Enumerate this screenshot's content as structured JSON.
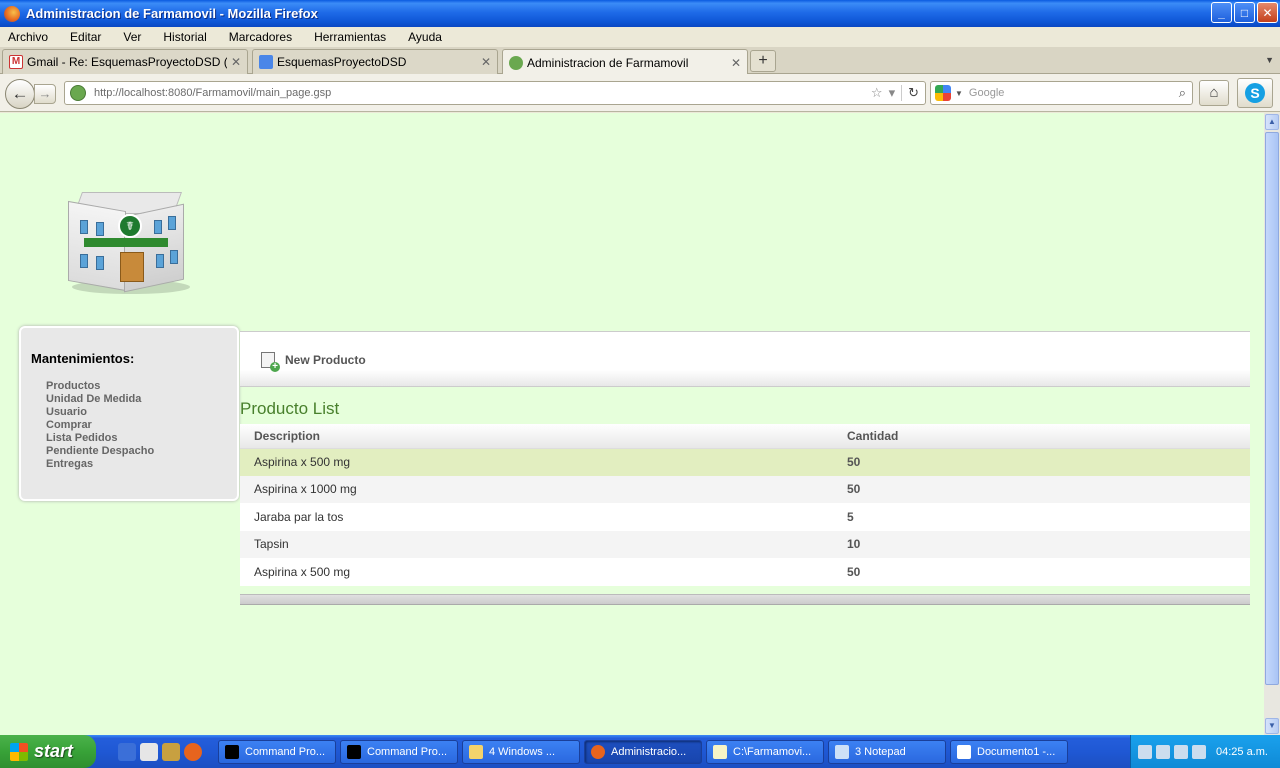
{
  "window": {
    "title": "Administracion de Farmamovil - Mozilla Firefox",
    "controls": {
      "minimize": "_",
      "maximize": "□",
      "close": "✕"
    }
  },
  "menubar": [
    "Archivo",
    "Editar",
    "Ver",
    "Historial",
    "Marcadores",
    "Herramientas",
    "Ayuda"
  ],
  "tabs": [
    {
      "label": "Gmail - Re: EsquemasProyectoDSD (ymal...",
      "icon": "gmail-icon",
      "close": "✕"
    },
    {
      "label": "EsquemasProyectoDSD",
      "icon": "doc-icon",
      "close": "✕"
    },
    {
      "label": "Administracion de Farmamovil",
      "icon": "site-icon",
      "close": "✕",
      "active": true
    }
  ],
  "newtab_label": "+",
  "nav": {
    "back": "←",
    "forward": "→",
    "url": "http://localhost:8080/Farmamovil/main_page.gsp",
    "bookmark_star": "☆",
    "dropdown": "▾",
    "reload": "↻",
    "search_placeholder": "Google",
    "search_icon": "⌕",
    "home": "⌂",
    "skype": "S"
  },
  "logo": {
    "sign": "☤"
  },
  "sidebar": {
    "title": "Mantenimientos:",
    "items": [
      "Productos",
      "Unidad De Medida",
      "Usuario",
      "Comprar",
      "Lista Pedidos",
      "Pendiente Despacho",
      "Entregas"
    ]
  },
  "actions": {
    "new_producto": "New Producto"
  },
  "list": {
    "title": "Producto List",
    "columns": [
      "Description",
      "Cantidad"
    ],
    "rows": [
      {
        "description": "Aspirina x 500 mg",
        "cantidad": "50"
      },
      {
        "description": "Aspirina x 1000 mg",
        "cantidad": "50"
      },
      {
        "description": "Jaraba par la tos",
        "cantidad": "5"
      },
      {
        "description": "Tapsin",
        "cantidad": "10"
      },
      {
        "description": "Aspirina x 500 mg",
        "cantidad": "50"
      }
    ]
  },
  "taskbar": {
    "start": "start",
    "tasks": [
      "Command Pro...",
      "Command Pro...",
      "4 Windows ...",
      "Administracio...",
      "C:\\Farmamovi...",
      "3 Notepad",
      "Documento1 -..."
    ],
    "clock": "04:25 a.m."
  },
  "colors": {
    "page_background": "#e6ffdb",
    "accent_green": "#48802c",
    "selected_row": "#e2eec0"
  }
}
